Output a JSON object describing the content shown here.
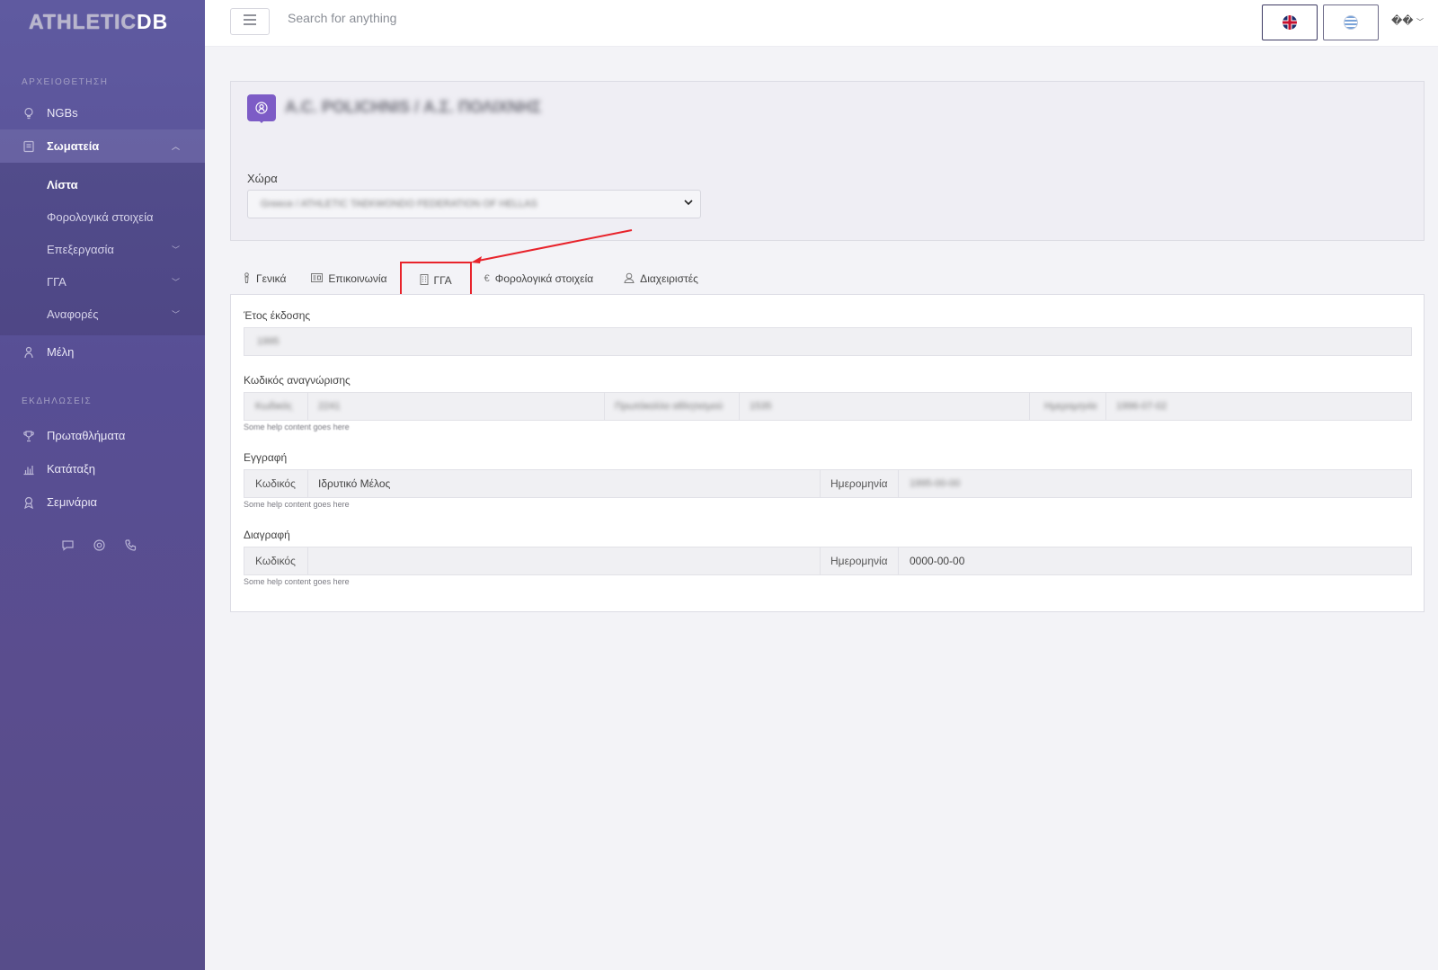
{
  "brand": {
    "logo_light": "ATHLETIC",
    "logo_bold": "DB"
  },
  "sidebar": {
    "section_archive": "ΑΡΧΕΙΟΘΕΤΗΣΗ",
    "ngbs": "NGBs",
    "clubs": "Σωματεία",
    "sub": {
      "list": "Λίστα",
      "tax": "Φορολογικά στοιχεία",
      "processing": "Επεξεργασία",
      "gga": "ΓΓΑ",
      "reports": "Αναφορές"
    },
    "members": "Μέλη",
    "section_events": "ΕΚΔΗΛΩΣΕΙΣ",
    "championships": "Πρωταθλήματα",
    "ranking": "Κατάταξη",
    "seminars": "Σεμινάρια"
  },
  "topbar": {
    "search_placeholder": "Search for anything",
    "user_menu": "��"
  },
  "club": {
    "name": "A.C. POLICHNIS / Α.Σ. ΠΟΛΙΧΝΗΣ",
    "country_label": "Χώρα",
    "country_value": "Greece / ATHLETIC TAEKWONDO FEDERATION OF HELLAS"
  },
  "tabs": {
    "general": "Γενικά",
    "contact": "Επικοινωνία",
    "gga": "ΓΓΑ",
    "tax": "Φορολογικά στοιχεία",
    "admins": "Διαχειριστές"
  },
  "gga": {
    "year_label": "Έτος έκδοσης",
    "year_value": "1995",
    "recognition_label": "Κωδικός αναγνώρισης",
    "recognition": {
      "code_label": "Κωδικός",
      "code_value": "2241",
      "protocol_label": "Πρωτόκολλο αθλητισμού",
      "protocol_value": "1535",
      "date_label": "Ημερομηνία",
      "date_value": "1996-07-02"
    },
    "help_text": "Some help content goes here",
    "registration_label": "Εγγραφή",
    "registration": {
      "code_label": "Κωδικός",
      "code_value": "Ιδρυτικό Μέλος",
      "date_label": "Ημερομηνία",
      "date_value": "1995-00-00"
    },
    "deletion_label": "Διαγραφή",
    "deletion": {
      "code_label": "Κωδικός",
      "code_value": "",
      "date_label": "Ημερομηνία",
      "date_value": "0000-00-00"
    }
  }
}
